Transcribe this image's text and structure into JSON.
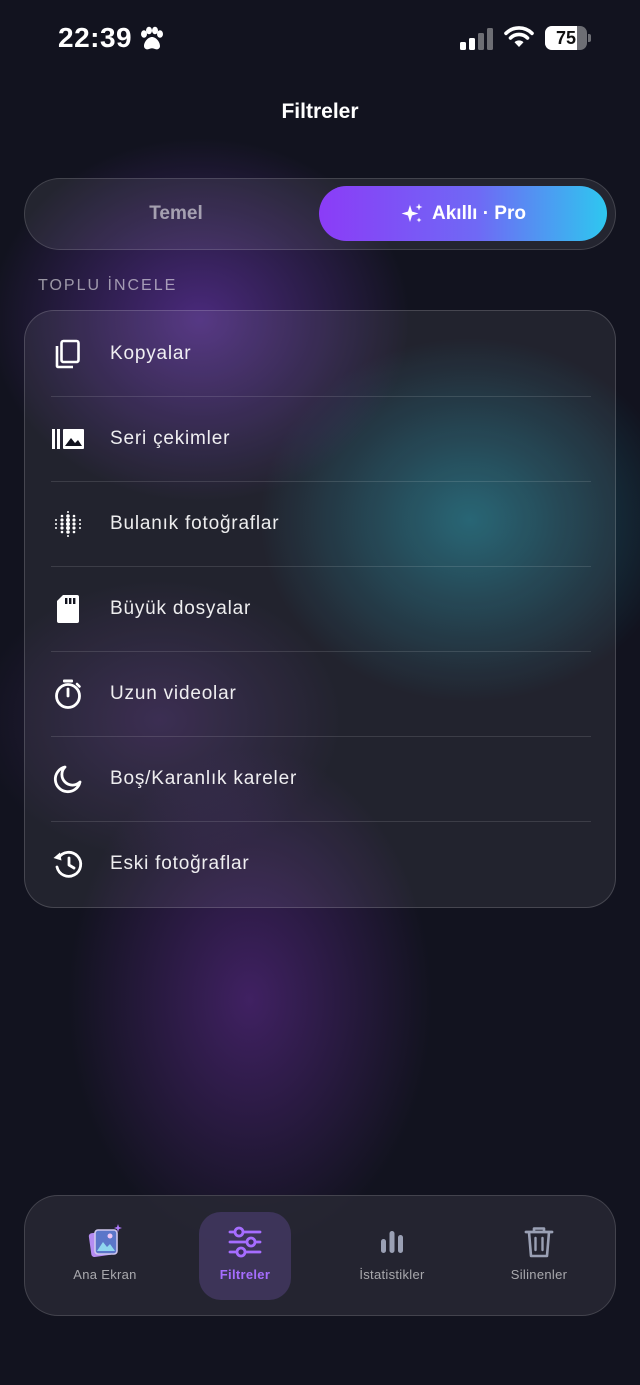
{
  "status_bar": {
    "time": "22:39",
    "battery_level": "75",
    "battery_fraction": 0.75,
    "icons": [
      "paw-icon",
      "cellular-signal-icon",
      "wifi-icon",
      "battery-icon"
    ]
  },
  "header": {
    "title": "Filtreler"
  },
  "segmented_control": {
    "options": [
      {
        "label": "Temel",
        "selected": false
      },
      {
        "label": "Akıllı · Pro",
        "selected": true,
        "icon": "sparkles-icon"
      }
    ],
    "active_gradient": [
      "#8b3cf7",
      "#2ec7ef"
    ]
  },
  "section": {
    "title": "TOPLU İNCELE"
  },
  "review_items": [
    {
      "label": "Kopyalar",
      "icon": "copy-icon"
    },
    {
      "label": "Seri çekimler",
      "icon": "burst-photos-icon"
    },
    {
      "label": "Bulanık fotoğraflar",
      "icon": "blur-icon"
    },
    {
      "label": "Büyük dosyalar",
      "icon": "sd-card-icon"
    },
    {
      "label": "Uzun videolar",
      "icon": "timer-icon"
    },
    {
      "label": "Boş/Karanlık kareler",
      "icon": "moon-icon"
    },
    {
      "label": "Eski fotoğraflar",
      "icon": "history-icon"
    }
  ],
  "tab_bar": {
    "tabs": [
      {
        "label": "Ana Ekran",
        "icon": "home-photo-icon",
        "active": false
      },
      {
        "label": "Filtreler",
        "icon": "sliders-icon",
        "active": true
      },
      {
        "label": "İstatistikler",
        "icon": "bar-chart-icon",
        "active": false
      },
      {
        "label": "Silinenler",
        "icon": "trash-icon",
        "active": false
      }
    ],
    "accent_color": "#a66dff"
  }
}
